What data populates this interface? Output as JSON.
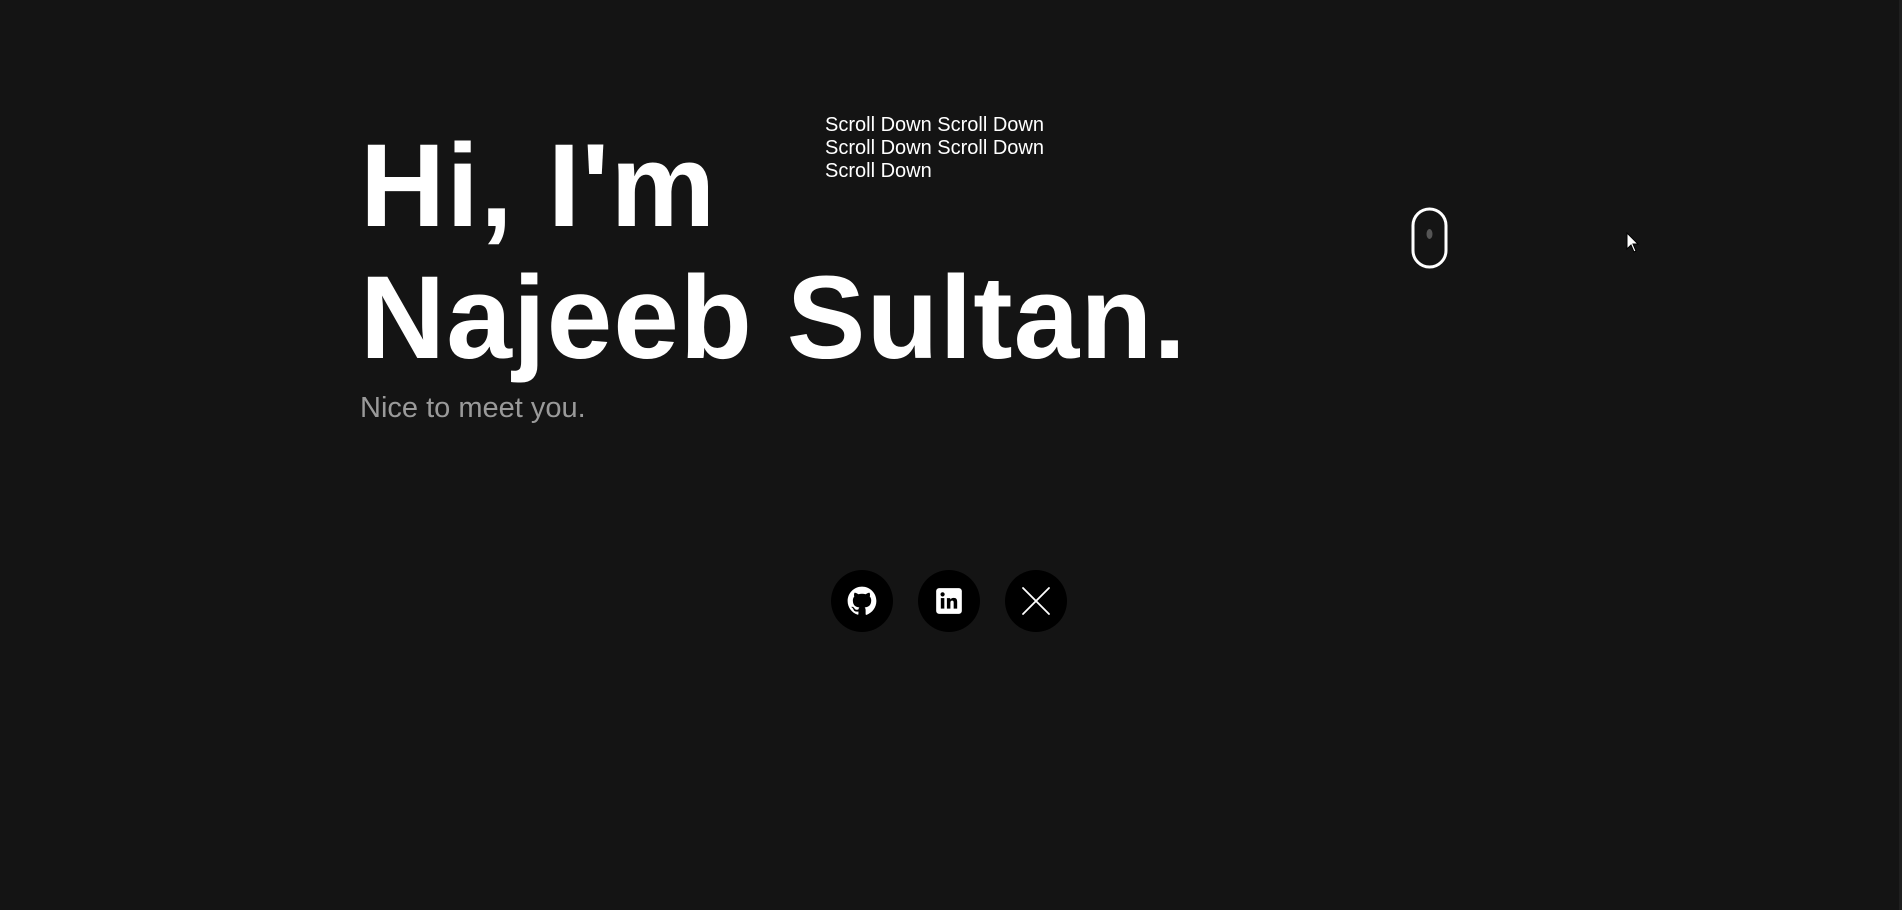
{
  "hero": {
    "greeting_line1": "Hi, I'm",
    "greeting_line2": "Najeeb Sultan.",
    "subtitle": "Nice to meet you."
  },
  "scroll_indicator": {
    "marquee_text": "Scroll Down Scroll Down Scroll Down Scroll Down Scroll Down",
    "icon": "mouse-icon"
  },
  "social_links": [
    {
      "name": "GitHub",
      "icon": "github-icon"
    },
    {
      "name": "LinkedIn",
      "icon": "linkedin-icon"
    },
    {
      "name": "X",
      "icon": "x-icon"
    }
  ],
  "colors": {
    "background": "#141414",
    "text": "#ffffff",
    "subtitle": "#9a9a9a",
    "social_bg": "#000000"
  }
}
